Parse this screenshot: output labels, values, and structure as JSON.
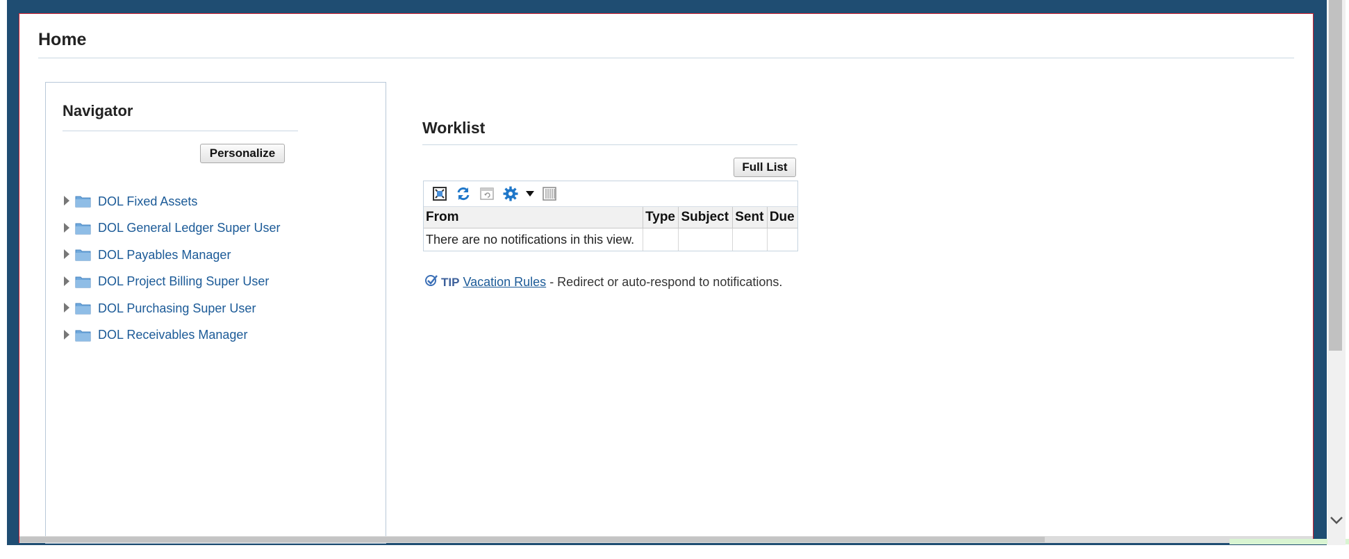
{
  "page": {
    "title": "Home"
  },
  "navigator": {
    "title": "Navigator",
    "personalize_label": "Personalize",
    "items": [
      {
        "label": "DOL Fixed Assets"
      },
      {
        "label": "DOL General Ledger Super User"
      },
      {
        "label": "DOL Payables Manager"
      },
      {
        "label": "DOL Project Billing Super User"
      },
      {
        "label": "DOL Purchasing Super User"
      },
      {
        "label": "DOL Receivables Manager"
      }
    ]
  },
  "worklist": {
    "title": "Worklist",
    "full_list_label": "Full List",
    "toolbar_icons": [
      "detach-icon",
      "refresh-icon",
      "freeze-icon",
      "settings-gear-icon",
      "columns-icon"
    ],
    "columns": [
      "From",
      "Type",
      "Subject",
      "Sent",
      "Due"
    ],
    "empty_message": "There are no notifications in this view.",
    "tip": {
      "label": "TIP",
      "link_text": "Vacation Rules",
      "text": " - Redirect or auto-respond to notifications."
    }
  },
  "colors": {
    "frame": "#1f4d72",
    "link": "#1b5a97",
    "border_highlight": "#d2202f",
    "folder": "#6fa8dc"
  }
}
